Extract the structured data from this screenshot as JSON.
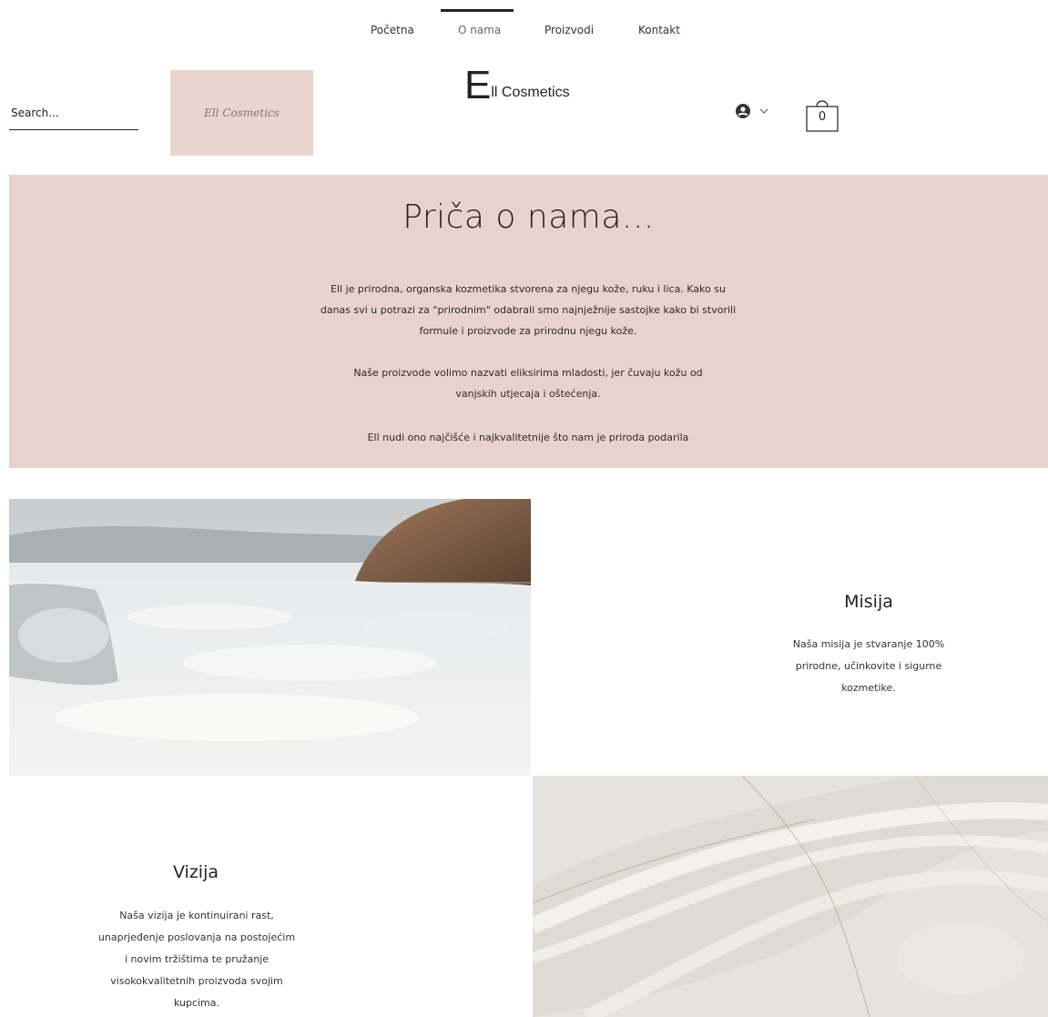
{
  "nav": {
    "items": [
      {
        "label": "Početna"
      },
      {
        "label": "O nama"
      },
      {
        "label": "Proizvodi"
      },
      {
        "label": "Kontakt"
      }
    ]
  },
  "header": {
    "search_placeholder": "Search...",
    "logo_text": "Ell Cosmetics",
    "brand_initial": "E",
    "brand_rest": "ll Cosmetics",
    "cart_count": "0"
  },
  "about": {
    "title": "Priča o nama...",
    "p1": "Ell je prirodna, organska kozmetika stvorena za njegu kože, ruku i lica. Kako su danas svi u potrazi za \"prirodnim\" odabrali smo najnježnije sastojke kako bi stvorili formule i proizvode za prirodnu njegu kože.",
    "p2": "Naše proizvode volimo nazvati eliksirima mladosti, jer čuvaju kožu od vanjskih utjecaja i oštećenja.",
    "p3": "Ell nudi ono najčišće i najkvalitetnije što nam je priroda podarila"
  },
  "mission": {
    "title": "Misija",
    "text": "Naša misija je stvaranje 100% prirodne, učinkovite i sigurne kozmetike."
  },
  "vision": {
    "title": "Vizija",
    "text": "Naša vizija je kontinuirani rast, unaprjeđenje poslovanja na postojećim i novim tržištima te pružanje visokokvalitetnih proizvoda svojim kupcima."
  },
  "colors": {
    "accent_pink": "#e9d2cd",
    "text_dark": "#222222"
  }
}
